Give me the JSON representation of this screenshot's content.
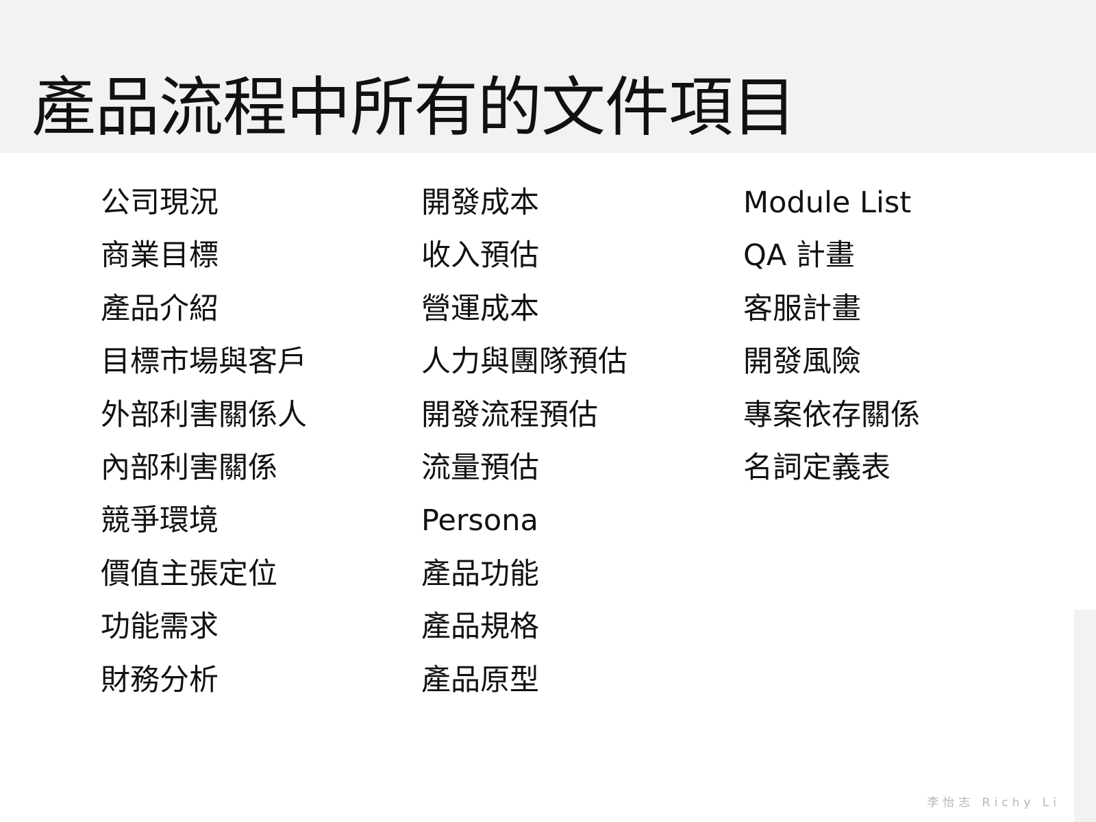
{
  "slide": {
    "title": "產品流程中所有的文件項目",
    "footer": "李怡志 Richy Li"
  },
  "columns": [
    {
      "items": [
        "公司現況",
        "商業目標",
        "產品介紹",
        "目標市場與客戶",
        "外部利害關係人",
        "內部利害關係",
        "競爭環境",
        "價值主張定位",
        "功能需求",
        "財務分析"
      ]
    },
    {
      "items": [
        "開發成本",
        "收入預估",
        "營運成本",
        "人力與團隊預估",
        "開發流程預估",
        "流量預估",
        "Persona",
        "產品功能",
        "產品規格",
        "產品原型"
      ]
    },
    {
      "items": [
        "Module List",
        "QA 計畫",
        "客服計畫",
        "開發風險",
        "專案依存關係",
        "名詞定義表"
      ]
    }
  ]
}
